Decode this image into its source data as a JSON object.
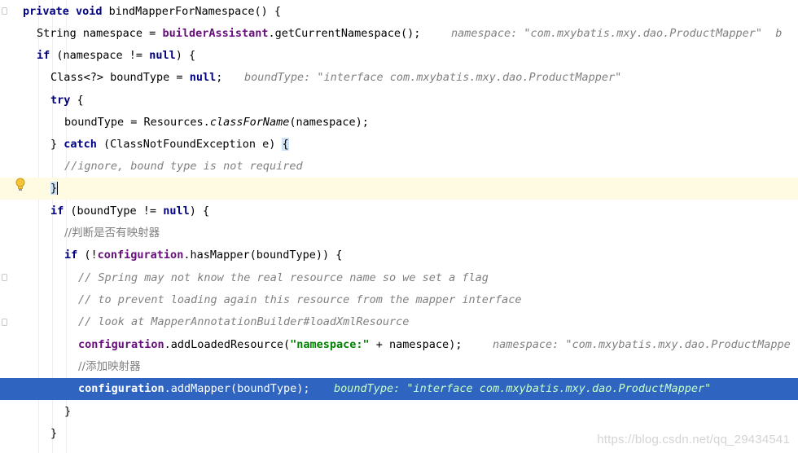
{
  "editor": {
    "lines": {
      "l1": {
        "kw": "private void ",
        "name": "bindMapperForNamespace",
        "rest": "() {"
      },
      "l2": {
        "type": "String namespace = ",
        "field": "builderAssistant",
        "call": ".getCurrentNamespace();",
        "inline": "namespace: \"com.mxybatis.mxy.dao.ProductMapper\"  b"
      },
      "l3": {
        "kw": "if ",
        "a": "(namespace != ",
        "null": "null",
        "b": ") {"
      },
      "l4": {
        "a": "Class<?> boundType = ",
        "null": "null",
        "b": ";",
        "inline": "boundType: \"interface com.mxybatis.mxy.dao.ProductMapper\""
      },
      "l5": {
        "kw": "try",
        "b": " {"
      },
      "l6": {
        "a": "boundType = Resources.",
        "m": "classForName",
        "b": "(namespace);"
      },
      "l7": {
        "a": "} ",
        "kw": "catch",
        "b": " (ClassNotFoundException e) ",
        "brace": "{"
      },
      "l8": {
        "cmt": "//ignore, bound type is not required"
      },
      "l9": {
        "brace": "}"
      },
      "l10": {
        "kw": "if",
        "a": " (boundType != ",
        "null": "null",
        "b": ") {"
      },
      "l11": {
        "cmt": "//判断是否有映射器"
      },
      "l12": {
        "kw": "if",
        "a": " (!",
        "field": "configuration",
        "b": ".hasMapper(boundType)) {"
      },
      "l13": {
        "cmt": "// Spring may not know the real resource name so we set a flag"
      },
      "l14": {
        "cmt": "// to prevent loading again this resource from the mapper interface"
      },
      "l15": {
        "cmt": "// look at MapperAnnotationBuilder#loadXmlResource"
      },
      "l16": {
        "field": "configuration",
        "a": ".addLoadedResource(",
        "str": "\"namespace:\"",
        "b": " + namespace);",
        "inline": "namespace: \"com.mxybatis.mxy.dao.ProductMappe"
      },
      "l17": {
        "cmt": "//添加映射器"
      },
      "l18": {
        "field": "configuration",
        "a": ".addMapper(boundType);",
        "inline": "boundType: \"interface com.mxybatis.mxy.dao.ProductMapper\""
      },
      "l19": {
        "b": "}"
      },
      "l20": {
        "b": "}"
      }
    },
    "colors": {
      "debug_line_bg": "#2f65c0",
      "caret_line_bg": "#fffbe3",
      "keyword": "#000080",
      "field": "#660e7a",
      "string": "#008000",
      "comment": "#808080"
    },
    "icons": {
      "gutter_icon": "lightbulb-icon"
    }
  },
  "watermark": "https://blog.csdn.net/qq_29434541"
}
